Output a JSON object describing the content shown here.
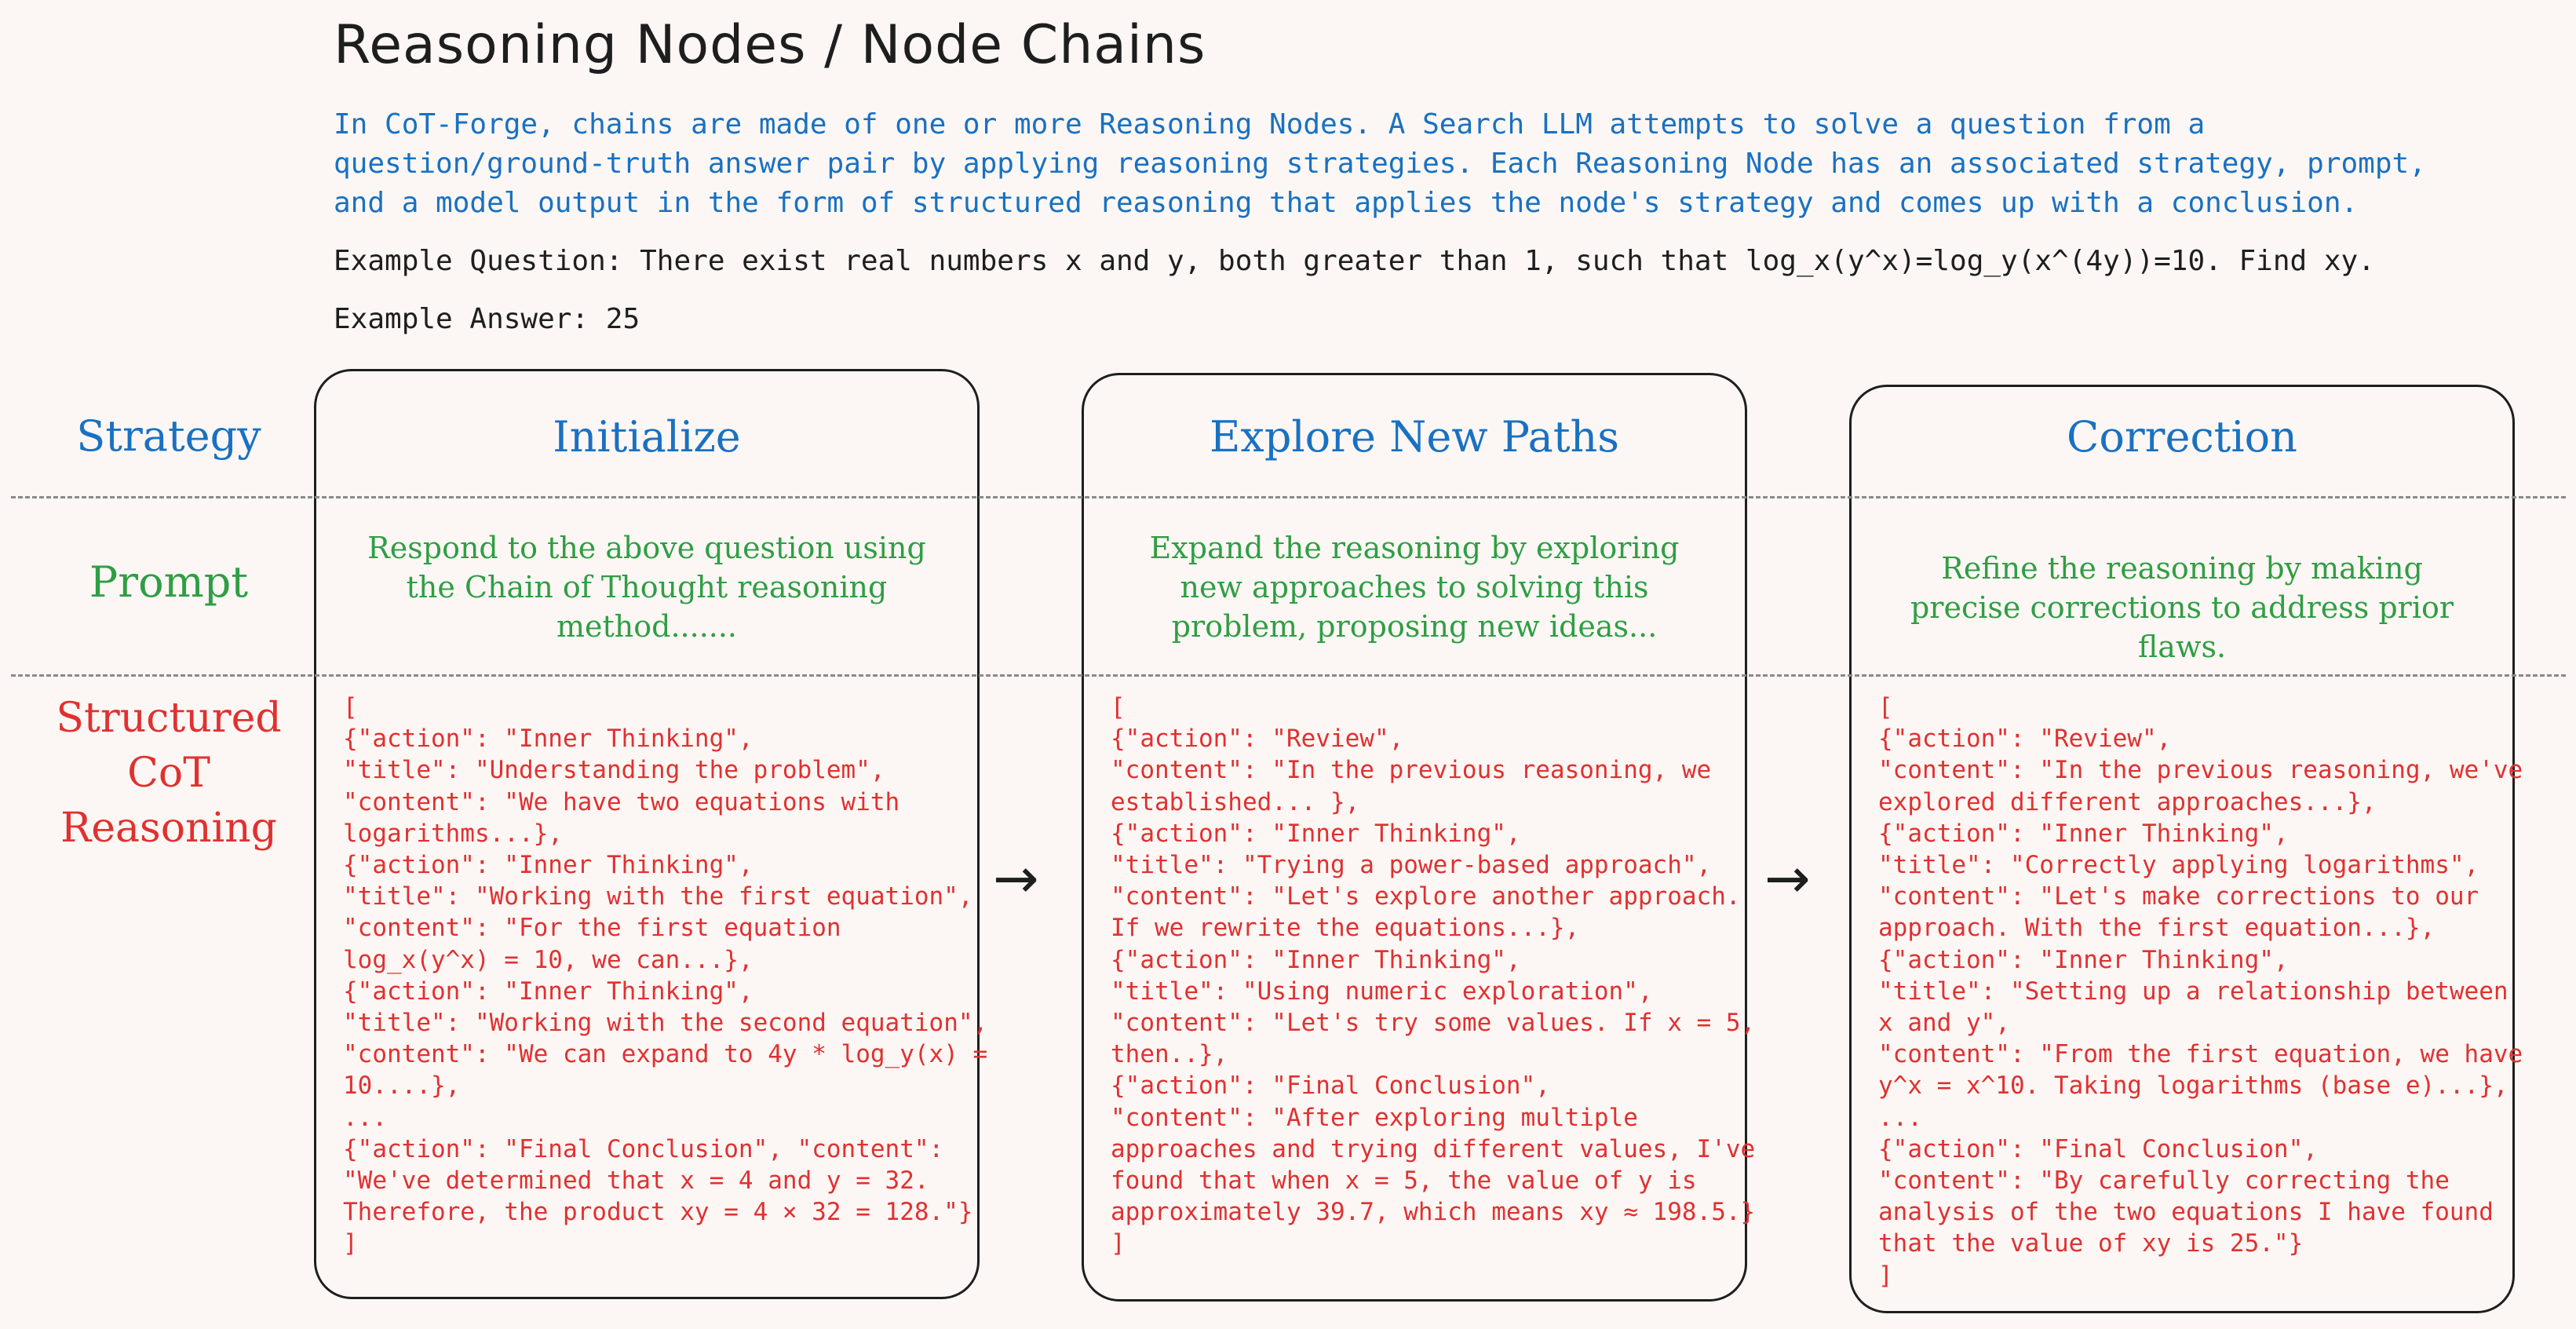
{
  "title": "Reasoning Nodes / Node Chains",
  "intro": "In CoT-Forge, chains are made of one or more Reasoning Nodes. A Search LLM attempts to solve a question from a\nquestion/ground-truth answer pair by applying reasoning strategies. Each Reasoning Node has an associated strategy, prompt,\nand a model output in the form of structured reasoning that applies the node's strategy and comes up with a conclusion.",
  "example_question": "Example Question: There exist real numbers x and y, both greater than 1, such that log_x(y^x)=log_y(x^(4y))=10. Find xy.",
  "example_answer": "Example Answer: 25",
  "row_labels": {
    "strategy": "Strategy",
    "prompt": "Prompt",
    "cot": "Structured\nCoT\nReasoning"
  },
  "arrow_glyph": "→",
  "nodes": [
    {
      "strategy": "Initialize",
      "prompt": "Respond to the above question using the Chain of Thought reasoning method.......",
      "output": "[\n{\"action\": \"Inner Thinking\",\n\"title\": \"Understanding the problem\",\n\"content\": \"We have two equations with\nlogarithms...},\n{\"action\": \"Inner Thinking\",\n\"title\": \"Working with the first equation\",\n\"content\": \"For the first equation\nlog_x(y^x) = 10, we can...},\n{\"action\": \"Inner Thinking\",\n\"title\": \"Working with the second equation\",\n\"content\": \"We can expand to 4y * log_y(x) =\n10....},\n...\n{\"action\": \"Final Conclusion\", \"content\":\n\"We've determined that x = 4 and y = 32.\nTherefore, the product xy = 4 × 32 = 128.\"}\n]"
    },
    {
      "strategy": "Explore New Paths",
      "prompt": "Expand the reasoning by exploring new approaches to solving this problem, proposing new ideas...",
      "output": "[\n{\"action\": \"Review\",\n\"content\": \"In the previous reasoning, we\nestablished... },\n{\"action\": \"Inner Thinking\",\n\"title\": \"Trying a power-based approach\",\n\"content\": \"Let's explore another approach.\nIf we rewrite the equations...},\n{\"action\": \"Inner Thinking\",\n\"title\": \"Using numeric exploration\",\n\"content\": \"Let's try some values. If x = 5,\nthen..},\n{\"action\": \"Final Conclusion\",\n\"content\": \"After exploring multiple\napproaches and trying different values, I've\nfound that when x = 5, the value of y is\napproximately 39.7, which means xy ≈ 198.5.}\n]"
    },
    {
      "strategy": "Correction",
      "prompt": "Refine the reasoning by making precise corrections to address prior flaws.",
      "output": "[\n{\"action\": \"Review\",\n\"content\": \"In the previous reasoning, we've\nexplored different approaches...},\n{\"action\": \"Inner Thinking\",\n\"title\": \"Correctly applying logarithms\",\n\"content\": \"Let's make corrections to our\napproach. With the first equation...},\n{\"action\": \"Inner Thinking\",\n\"title\": \"Setting up a relationship between\nx and y\",\n\"content\": \"From the first equation, we have\ny^x = x^10. Taking logarithms (base e)...},\n...\n{\"action\": \"Final Conclusion\",\n\"content\": \"By carefully correcting the\nanalysis of the two equations I have found\nthat the value of xy is 25.\"}\n]"
    }
  ]
}
